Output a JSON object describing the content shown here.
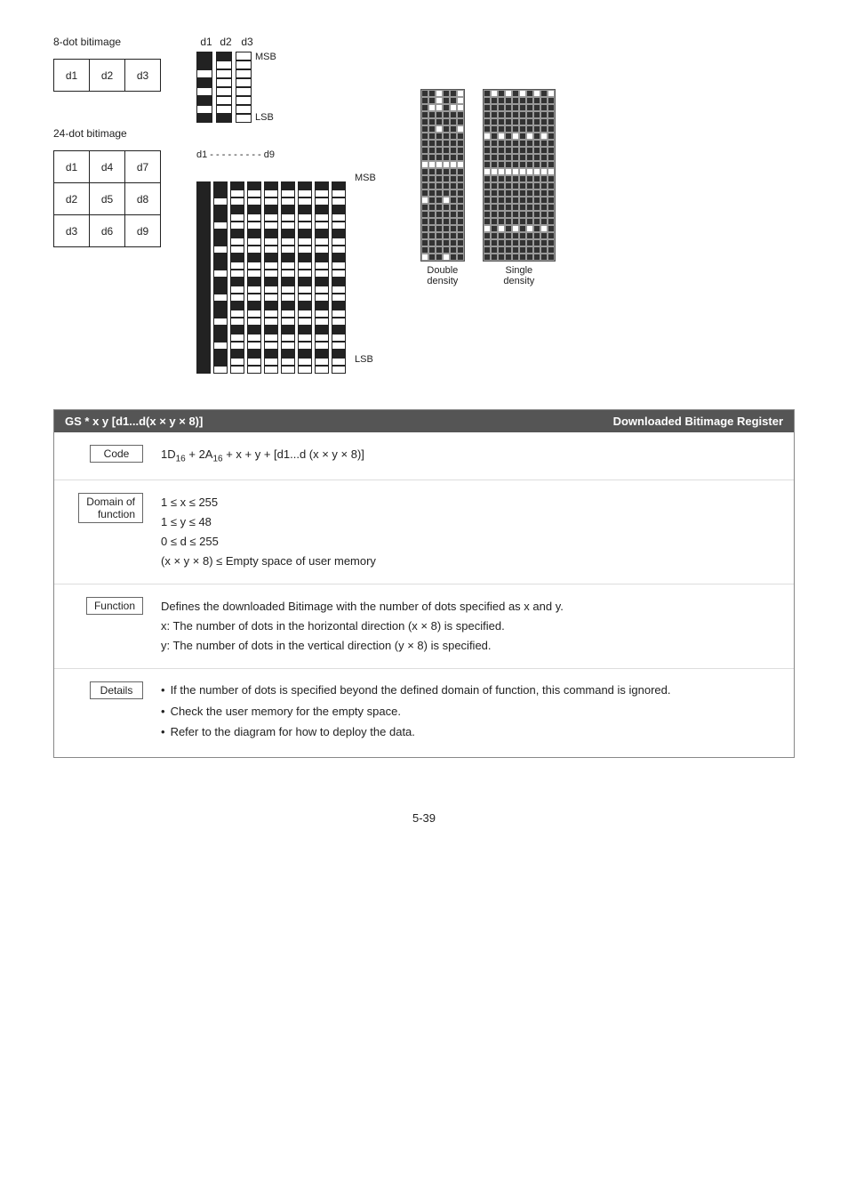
{
  "page": {
    "number": "5-39"
  },
  "diagrams": {
    "eightDot": {
      "label": "8-dot bitimage",
      "cells": [
        [
          "d1",
          "d2",
          "d3"
        ]
      ]
    },
    "twentyFourDot": {
      "label": "24-dot bitimage",
      "cells": [
        [
          "d1",
          "d4",
          "d7"
        ],
        [
          "d2",
          "d5",
          "d8"
        ],
        [
          "d3",
          "d6",
          "d9"
        ]
      ]
    },
    "col8Labels": [
      "d1",
      "d2",
      "d3"
    ],
    "col24LabelRow": "d1 - - - - - - - - - d9",
    "msb": "MSB",
    "lsb": "LSB",
    "densityLabels": [
      "Double\ndensity",
      "Single\ndensity"
    ]
  },
  "command": {
    "header_left": "GS * x y [d1...d(x × y × 8)]",
    "header_right": "Downloaded Bitimage Register",
    "rows": {
      "code": {
        "label": "Code",
        "value": "1D₁₆ + 2A₁₆ + x + y + [d1...d (x × y × 8)]"
      },
      "domain": {
        "label_line1": "Domain of",
        "label_line2": "function",
        "lines": [
          "1 ≤ x ≤ 255",
          "1 ≤ y ≤ 48",
          "0 ≤ d ≤ 255",
          "(x × y × 8) ≤ Empty space of user memory"
        ]
      },
      "function": {
        "label": "Function",
        "lines": [
          "Defines the downloaded Bitimage with the number of dots specified as x and y.",
          "x: The number of dots in the horizontal direction (x × 8) is specified.",
          "y: The number of dots in the vertical direction (y × 8) is specified."
        ]
      },
      "details": {
        "label": "Details",
        "bullets": [
          "If the number of dots is specified beyond the defined domain of function, this command is ignored.",
          "Check the user memory for the empty space.",
          "Refer to the diagram for how to deploy the data."
        ]
      }
    }
  }
}
